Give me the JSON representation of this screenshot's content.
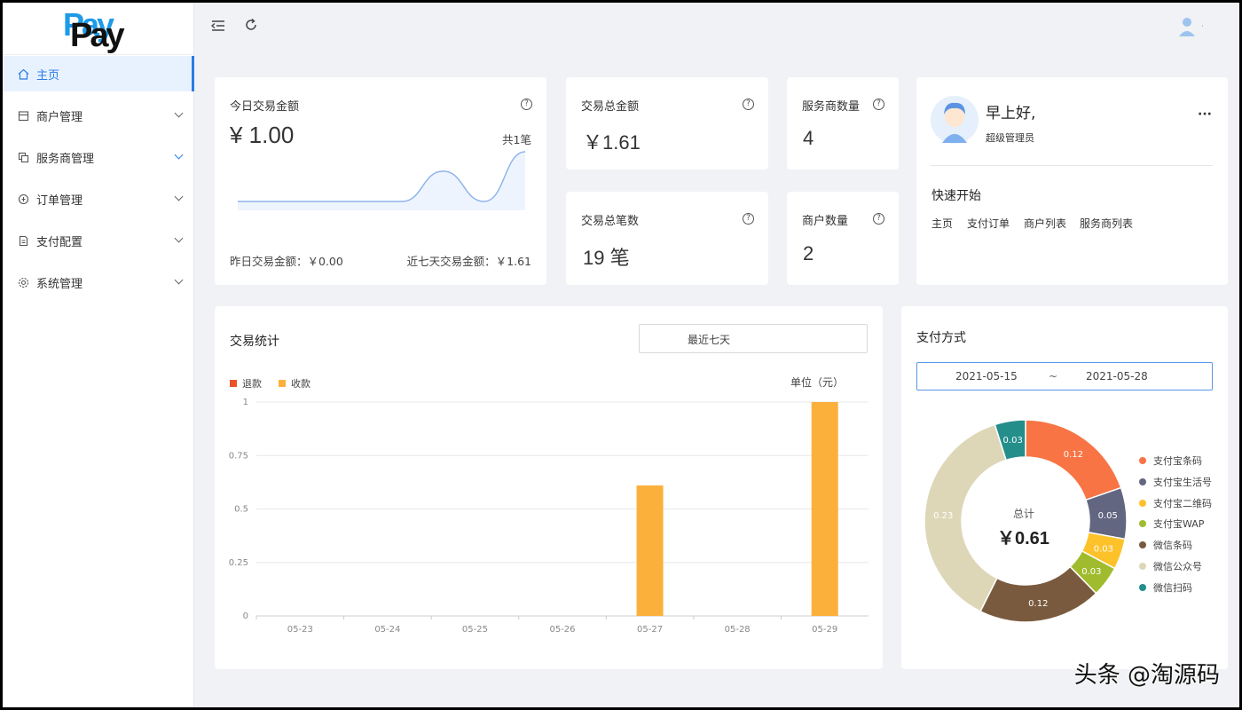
{
  "logo": {
    "text": "Pay"
  },
  "sidebar": {
    "items": [
      {
        "label": "主页",
        "icon": "home-icon",
        "active": true
      },
      {
        "label": "商户管理",
        "icon": "store-icon"
      },
      {
        "label": "服务商管理",
        "icon": "copy-icon"
      },
      {
        "label": "订单管理",
        "icon": "order-icon"
      },
      {
        "label": "支付配置",
        "icon": "config-icon"
      },
      {
        "label": "系统管理",
        "icon": "gear-icon"
      }
    ]
  },
  "today": {
    "title": "今日交易金额",
    "amount": "¥ 1.00",
    "count": "共1笔",
    "yesterday": "昨日交易金额：￥0.00",
    "seven_days": "近七天交易金额：￥1.61"
  },
  "stats": {
    "total_amount_title": "交易总金额",
    "total_amount": "￥1.61",
    "provider_count_title": "服务商数量",
    "provider_count": "4",
    "total_txn_title": "交易总笔数",
    "total_txn": "19 笔",
    "merchant_count_title": "商户数量",
    "merchant_count": "2"
  },
  "welcome": {
    "greeting": "早上好,",
    "role": "超级管理员",
    "more": "···",
    "quick_title": "快速开始",
    "links": [
      "主页",
      "支付订单",
      "商户列表",
      "服务商列表"
    ]
  },
  "txn_chart": {
    "title": "交易统计",
    "range": "最近七天",
    "unit": "单位（元）"
  },
  "pay_chart": {
    "title": "支付方式",
    "date_start": "2021-05-15",
    "date_sep": "~",
    "date_end": "2021-05-28",
    "total_label": "总计",
    "total_value": "￥0.61"
  },
  "watermark": "头条 @淘源码",
  "chart_data": [
    {
      "type": "line",
      "x": [
        1,
        2,
        3,
        4,
        5,
        6,
        7,
        8
      ],
      "values": [
        0,
        0,
        0,
        0,
        0,
        0.61,
        0,
        1.0
      ],
      "note_color": "#8fb4ec"
    },
    {
      "type": "bar",
      "categories": [
        "05-23",
        "05-24",
        "05-25",
        "05-26",
        "05-27",
        "05-28",
        "05-29"
      ],
      "series": [
        {
          "name": "退款",
          "color": "#e8532a",
          "values": [
            0,
            0,
            0,
            0,
            0,
            0,
            0
          ]
        },
        {
          "name": "收款",
          "color": "#fbb03b",
          "values": [
            0,
            0,
            0,
            0,
            0.61,
            0,
            1
          ]
        }
      ],
      "yticks": [
        "0",
        "0.25",
        "0.5",
        "0.75",
        "1"
      ],
      "ylim": [
        0,
        1
      ],
      "ylabel": "单位（元）",
      "legend": "top-left"
    },
    {
      "type": "pie",
      "categories": [
        "支付宝条码",
        "支付宝生活号",
        "支付宝二维码",
        "支付宝WAP",
        "微信条码",
        "微信公众号",
        "微信扫码"
      ],
      "values": [
        0.12,
        0.05,
        0.03,
        0.03,
        0.12,
        0.23,
        0.03
      ],
      "labels": [
        "0.12",
        "0.05",
        "0.03",
        "0.03",
        "0.12",
        "0.23",
        "0.03"
      ],
      "colors": [
        "#f87444",
        "#626681",
        "#fdc12a",
        "#a0bc2e",
        "#7a5a3e",
        "#ddd7b8",
        "#248e8b"
      ],
      "legend": "right"
    }
  ]
}
